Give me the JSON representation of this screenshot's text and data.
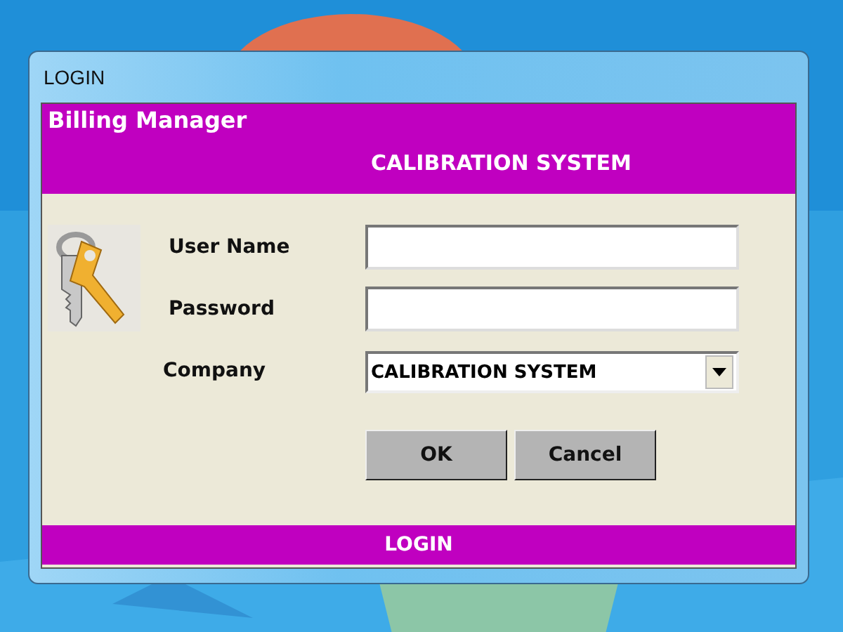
{
  "window": {
    "title": "LOGIN"
  },
  "header": {
    "app_name": "Billing Manager",
    "system_name": "CALIBRATION SYSTEM"
  },
  "fields": [
    {
      "label": "User Name",
      "kind": "text"
    },
    {
      "label": "Password",
      "kind": "password"
    },
    {
      "label": "Company",
      "kind": "dropdown",
      "value": "CALIBRATION SYSTEM"
    }
  ],
  "buttons": [
    "OK",
    "Cancel"
  ],
  "footer": "LOGIN"
}
